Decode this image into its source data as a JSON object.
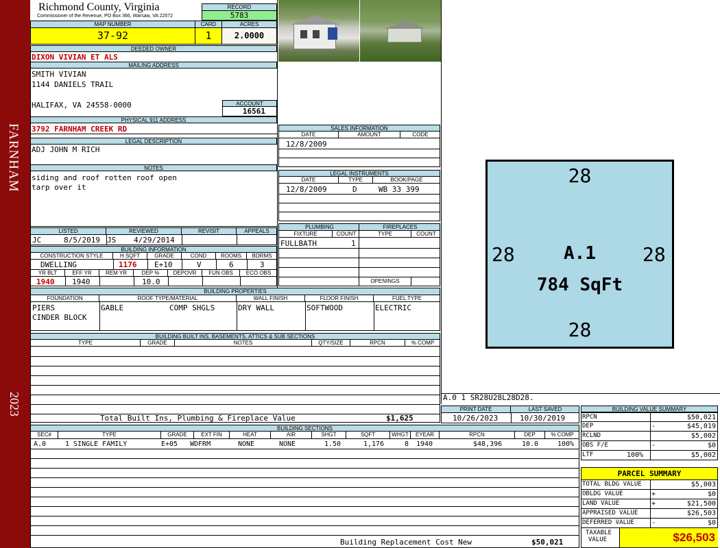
{
  "sidebar": {
    "district": "FARNHAM",
    "year": "2023",
    "color": "#8b0a0a"
  },
  "header": {
    "county": "Richmond County, Virginia",
    "commissioner": "Commissioner of the Revenue, PO Box 366, Warsaw, VA 22572",
    "record_label": "RECORD",
    "record": "5783",
    "map_number_label": "MAP NUMBER",
    "map_number": "37-92",
    "card_label": "CARD",
    "card": "1",
    "acres_label": "ACRES",
    "acres": "2.0000"
  },
  "owner": {
    "deeded_owner_label": "DEEDED OWNER",
    "deeded_owner": "DIXON VIVIAN ET ALS",
    "mailing_label": "MAILING ADDRESS",
    "mailing_lines": [
      "SMITH VIVIAN",
      "1144 DANIELS TRAIL",
      "",
      "HALIFAX, VA 24558-0000"
    ],
    "account_label": "ACCOUNT",
    "account": "16561",
    "physical_label": "PHYSICAL 911 ADDRESS",
    "physical": "3792 FARNHAM CREEK RD",
    "legal_label": "LEGAL DESCRIPTION",
    "legal": "ADJ JOHN M RICH",
    "notes_label": "NOTES",
    "notes_lines": [
      "siding and roof rotten roof open",
      "tarp over it"
    ]
  },
  "sales": {
    "label": "SALES INFORMATION",
    "cols": [
      "DATE",
      "AMOUNT",
      "CODE"
    ],
    "rows": [
      {
        "date": "12/8/2009",
        "amount": "",
        "code": ""
      }
    ]
  },
  "legal_instruments": {
    "label": "LEGAL INSTRUMENTS",
    "cols": [
      "DATE",
      "TYPE",
      "BOOK/PAGE"
    ],
    "rows": [
      {
        "date": "12/8/2009",
        "type": "D",
        "bookpage": "WB 33 399"
      }
    ]
  },
  "status": {
    "cols": [
      "LISTED",
      "REVIEWED",
      "REVISIT",
      "APPEALS"
    ],
    "listed_by": "JC",
    "listed_date": "8/5/2019",
    "reviewed_by": "JS",
    "reviewed_date": "4/29/2014",
    "revisit": "",
    "appeals": ""
  },
  "building_info": {
    "label": "BUILDING INFORMATION",
    "cols1": [
      "CONSTRUCTION STYLE",
      "H SQFT",
      "GRADE",
      "COND",
      "ROOMS",
      "BDRMS"
    ],
    "construction_style": "DWELLING",
    "h_sqft": "1176",
    "grade": "E+10",
    "cond": "V",
    "rooms": "6",
    "bdrms": "3",
    "cols2": [
      "YR BLT",
      "EFF YR",
      "REM YR",
      "DEP %",
      "DEPOVR",
      "FUN OBS",
      "ECO OBS"
    ],
    "yr_blt": "1940",
    "eff_yr": "1940",
    "rem_yr": "",
    "dep_pct": "10.0",
    "depovr": "",
    "fun_obs": "",
    "eco_obs": ""
  },
  "plumbing": {
    "label": "PLUMBING",
    "cols": [
      "FIXTURE",
      "COUNT"
    ],
    "fixture": "FULLBATH",
    "count": "1"
  },
  "fireplaces": {
    "label": "FIREPLACES",
    "cols": [
      "TYPE",
      "COUNT"
    ],
    "openings_label": "OPENINGS",
    "openings": ""
  },
  "building_properties": {
    "label": "BUILDING PROPERTIES",
    "cols": [
      "FOUNDATION",
      "ROOF TYPE/MATERIAL",
      "WALL FINISH",
      "FLOOR FINISH",
      "FUEL TYPE"
    ],
    "foundation": [
      "PIERS",
      "CINDER BLOCK"
    ],
    "roof_type": "GABLE",
    "roof_material": "COMP SHGLS",
    "wall": "DRY WALL",
    "floor": "SOFTWOOD",
    "fuel": "ELECTRIC"
  },
  "built_ins": {
    "label": "BUILDING BUILT INS, BASEMENTS, ATTICS & SUB SECTIONS",
    "cols": [
      "TYPE",
      "GRADE",
      "NOTES",
      "QTY/SIZE",
      "RPCN",
      "% COMP"
    ],
    "total_label": "Total Built Ins, Plumbing & Fireplace Value",
    "total": "$1,625"
  },
  "sketch": {
    "top": "28",
    "bottom": "28",
    "left": "28",
    "right": "28",
    "section": "A.1",
    "area": "784 SqFt",
    "fill": "#add8e6",
    "code_line": "A.0  1    SR28U28L28D28."
  },
  "dates": {
    "print_label": "PRINT DATE",
    "print_date": "10/26/2023",
    "saved_label": "LAST SAVED",
    "saved_date": "10/30/2019"
  },
  "building_sections": {
    "label": "BUILDING SECTIONS",
    "cols": [
      "SEC#",
      "TYPE",
      "GRADE",
      "EXT FIN",
      "HEAT",
      "AIR",
      "SHGT",
      "SQFT",
      "WHGT",
      "EYEAR",
      "RPCN",
      "DEP",
      "% COMP"
    ],
    "rows": [
      {
        "sec": "A.0",
        "type": "1 SINGLE FAMILY",
        "grade": "E+05",
        "ext": "WDFRM",
        "heat": "NONE",
        "air": "NONE",
        "shgt": "1.50",
        "sqft": "1,176",
        "whgt": "8",
        "eyear": "1940",
        "rpcn": "$48,396",
        "dep": "10.0",
        "comp": "100%"
      }
    ],
    "total_label": "Building Replacement Cost New",
    "total": "$50,021"
  },
  "value_summary": {
    "label": "BUILDING VALUE SUMMARY",
    "rows": [
      {
        "label": "RPCN",
        "sign": "",
        "value": "$50,021"
      },
      {
        "label": "DEP",
        "sign": "-",
        "value": "$45,019"
      },
      {
        "label": "RCLND",
        "sign": "",
        "value": "$5,002"
      },
      {
        "label": "OBS F/E",
        "sign": "-",
        "value": "$0"
      }
    ],
    "ltf_label": "LTF",
    "ltf_pct": "100%",
    "ltf_value": "$5,002"
  },
  "parcel_summary": {
    "label": "PARCEL SUMMARY",
    "rows": [
      {
        "label": "TOTAL BLDG VALUE",
        "sign": "",
        "value": "$5,003"
      },
      {
        "label": "OBLDG VALUE",
        "sign": "+",
        "value": "$0"
      },
      {
        "label": "LAND VALUE",
        "sign": "+",
        "value": "$21,500"
      },
      {
        "label": "APPRAISED VALUE",
        "sign": "",
        "value": "$26,503"
      },
      {
        "label": "DEFERRED VALUE",
        "sign": "-",
        "value": "$0"
      }
    ],
    "taxable_label_1": "TAXABLE",
    "taxable_label_2": "VALUE",
    "taxable": "$26,503"
  },
  "colors": {
    "header_blue": "#b9dce6",
    "yellow": "#ffff00",
    "green": "#90ee90",
    "red_text": "#c00000"
  }
}
